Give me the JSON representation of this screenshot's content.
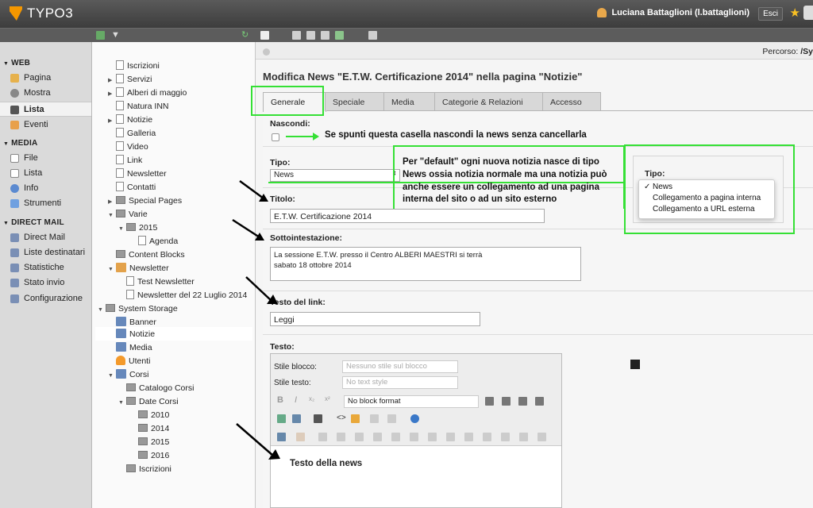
{
  "topbar": {
    "logo_text": "TYPO3",
    "user_name": "Luciana Battaglioni (l.battaglioni)",
    "logout_label": "Esci"
  },
  "modules": {
    "web_label": "WEB",
    "web_items": [
      "Pagina",
      "Mostra",
      "Lista",
      "Eventi"
    ],
    "media_label": "MEDIA",
    "media_items": [
      "File",
      "Lista",
      "Info",
      "Strumenti"
    ],
    "directmail_label": "DIRECT MAIL",
    "directmail_items": [
      "Direct Mail",
      "Liste destinatari",
      "Statistiche",
      "Stato invio",
      "Configurazione"
    ],
    "active": "Lista"
  },
  "tree": {
    "items": [
      "Iscrizioni",
      "Servizi",
      "Alberi di maggio",
      "Natura INN",
      "Notizie",
      "Galleria",
      "Video",
      "Link",
      "Newsletter",
      "Contatti",
      "Special Pages",
      "Varie",
      "2015",
      "Agenda",
      "Content Blocks",
      "Newsletter",
      "Test Newsletter",
      "Newsletter del 22 Luglio 2014",
      "System Storage",
      "Banner",
      "Notizie",
      "Media",
      "Utenti",
      "Corsi",
      "Catalogo Corsi",
      "Date Corsi",
      "2010",
      "2014",
      "2015",
      "2016",
      "Iscrizioni"
    ]
  },
  "main": {
    "percorso_label": "Percorso:",
    "percorso_value": "/Sy",
    "title": "Modifica News \"E.T.W. Certificazione 2014\" nella pagina \"Notizie\"",
    "tabs": [
      "Generale",
      "Speciale",
      "Media",
      "Categorie & Relazioni",
      "Accesso"
    ],
    "active_tab": "Generale",
    "nascondi_label": "Nascondi:",
    "tipo_label": "Tipo:",
    "tipo_value": "News",
    "titolo_label": "Titolo:",
    "titolo_value": "E.T.W. Certificazione 2014",
    "sotto_label": "Sottointestazione:",
    "sotto_line1": "La sessione E.T.W. presso il Centro ALBERI MAESTRI si terrà",
    "sotto_line2": "sabato 18 ottobre 2014",
    "link_label": "Testo del link:",
    "link_value": "Leggi",
    "testo_label": "Testo:"
  },
  "rte": {
    "stile_blocco_label": "Stile blocco:",
    "stile_blocco_value": "Nessuno stile sul blocco",
    "stile_testo_label": "Stile testo:",
    "stile_testo_value": "No text style",
    "block_format_value": "No block format",
    "body_text": "Testo della news"
  },
  "annotations": {
    "nascondi_note": "Se spunti questa casella nascondi la news senza cancellarla",
    "tipo_note_1": "Per \"default\" ogni nuova notizia nasce di tipo",
    "tipo_note_2": "News ossia notizia normale ma una notizia può",
    "tipo_note_3": "anche essere un collegamento ad una pagina",
    "tipo_note_4": "interna del sito o ad un sito esterno",
    "popup_label": "Tipo:",
    "popup_options": [
      "News",
      "Collegamento a pagina interna",
      "Collegamento a URL esterna"
    ],
    "accent_color": "#35e035"
  }
}
